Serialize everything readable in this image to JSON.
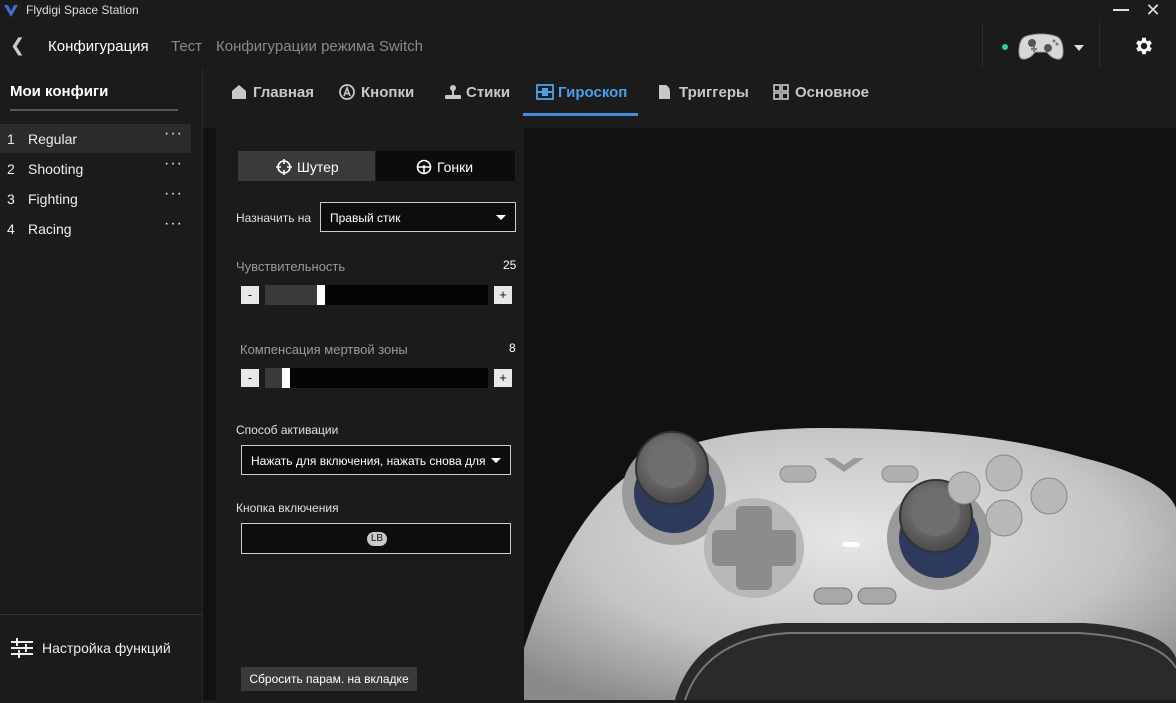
{
  "app": {
    "title": "Flydigi Space Station"
  },
  "header": {
    "back_icon": "chevron-left-icon",
    "breadcrumbs": [
      "Конфигурация",
      "Тест",
      "Конфигурации режима Switch"
    ],
    "device_status_color": "#29d38a"
  },
  "sidebar": {
    "title": "Мои конфиги",
    "configs": [
      {
        "num": "1",
        "name": "Regular",
        "menu": "···"
      },
      {
        "num": "2",
        "name": "Shooting",
        "menu": "···"
      },
      {
        "num": "3",
        "name": "Fighting",
        "menu": "···"
      },
      {
        "num": "4",
        "name": "Racing",
        "menu": "···"
      }
    ],
    "function_settings": "Настройка функций"
  },
  "tabs": [
    {
      "label": "Главная",
      "icon": "home-icon"
    },
    {
      "label": "Кнопки",
      "icon": "a-button-icon"
    },
    {
      "label": "Стики",
      "icon": "joystick-icon"
    },
    {
      "label": "Гироскоп",
      "icon": "gyro-icon",
      "active": true
    },
    {
      "label": "Триггеры",
      "icon": "trigger-icon"
    },
    {
      "label": "Основное",
      "icon": "grid-icon"
    }
  ],
  "gyro": {
    "mode_shooter": "Шутер",
    "mode_racing": "Гонки",
    "assign_label": "Назначить на",
    "assign_value": "Правый стик",
    "sensitivity_label": "Чувствительность",
    "sensitivity_value": "25",
    "sensitivity_fraction": 0.235,
    "deadzone_label": "Компенсация мертвой зоны",
    "deadzone_value": "8",
    "deadzone_fraction": 0.075,
    "minus": "-",
    "plus": "+",
    "activation_label": "Способ активации",
    "activation_value": "Нажать для включения, нажать снова для",
    "enable_button_label": "Кнопка включения",
    "enable_button_value": "LB",
    "reset_label": "Сбросить парам. на вкладке"
  },
  "accent_color": "#3e8fe0"
}
